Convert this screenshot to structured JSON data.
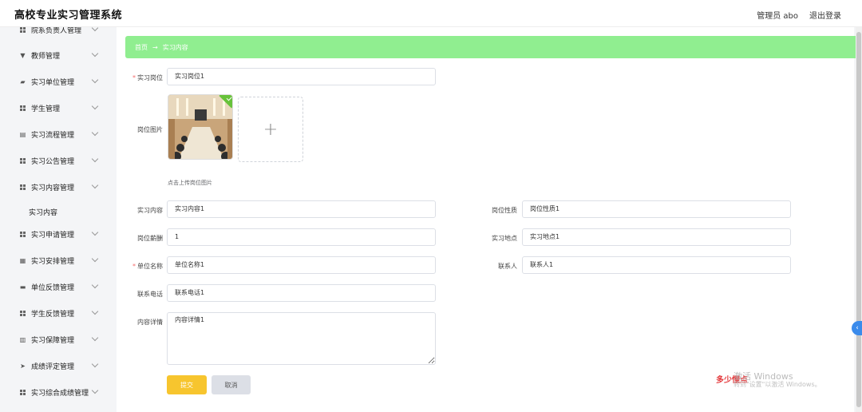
{
  "header": {
    "title": "高校专业实习管理系统",
    "user": "管理员 abo",
    "logout": "退出登录"
  },
  "sidebar": {
    "items": [
      {
        "label": "院系负责人管理",
        "icon": "grid-icon"
      },
      {
        "label": "教师管理",
        "icon": "teacher-icon"
      },
      {
        "label": "实习单位管理",
        "icon": "company-icon"
      },
      {
        "label": "学生管理",
        "icon": "grid-icon"
      },
      {
        "label": "实习流程管理",
        "icon": "process-icon"
      },
      {
        "label": "实习公告管理",
        "icon": "grid-icon"
      },
      {
        "label": "实习内容管理",
        "icon": "grid-icon"
      },
      {
        "label": "实习申请管理",
        "icon": "grid-icon"
      },
      {
        "label": "实习安排管理",
        "icon": "arrange-icon"
      },
      {
        "label": "单位反馈管理",
        "icon": "feedback-icon"
      },
      {
        "label": "学生反馈管理",
        "icon": "grid-icon"
      },
      {
        "label": "实习保障管理",
        "icon": "table-icon"
      },
      {
        "label": "成绩评定管理",
        "icon": "send-icon"
      },
      {
        "label": "实习综合成绩管理",
        "icon": "grid-icon"
      }
    ],
    "sub_item": "实习内容"
  },
  "breadcrumb": {
    "home": "首页",
    "arrow": "→",
    "current": "实习内容"
  },
  "form": {
    "position": {
      "label": "实习岗位",
      "value": "实习岗位1"
    },
    "image": {
      "label": "岗位图片",
      "hint": "点击上传岗位图片",
      "plus": "+"
    },
    "content": {
      "label": "实习内容",
      "value": "实习内容1"
    },
    "nature": {
      "label": "岗位性质",
      "value": "岗位性质1"
    },
    "salary": {
      "label": "岗位薪酬",
      "value": "1"
    },
    "location": {
      "label": "实习地点",
      "value": "实习地点1"
    },
    "company": {
      "label": "单位名称",
      "value": "单位名称1"
    },
    "contact": {
      "label": "联系人",
      "value": "联系人1"
    },
    "phone": {
      "label": "联系电话",
      "value": "联系电话1"
    },
    "detail": {
      "label": "内容详情",
      "value": "内容详情1"
    },
    "required_mark": "*",
    "submit": "提交",
    "cancel": "取消"
  },
  "watermark": {
    "brand": "多少懂点",
    "line1": "激活 Windows",
    "line2": "转到\"设置\"以激活 Windows。"
  },
  "colors": {
    "breadcrumb_bg": "#90ee90",
    "submit_bg": "#f7c52e",
    "required": "#f56c6c"
  }
}
